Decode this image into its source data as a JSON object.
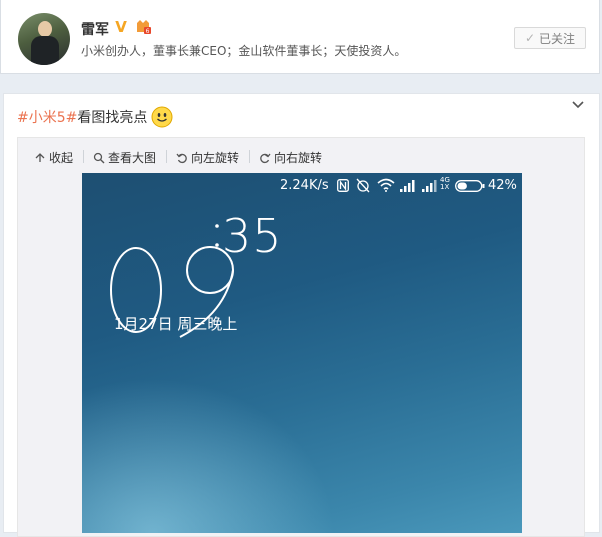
{
  "profile": {
    "name": "雷军",
    "bio": "小米创办人，董事长兼CEO；金山软件董事长；天使投资人。",
    "follow_label": "已关注"
  },
  "post": {
    "hashtag": "#小米5#",
    "text": " 看图找亮点"
  },
  "media_toolbar": {
    "collapse": "收起",
    "view_large": "查看大图",
    "rotate_left": "向左旋转",
    "rotate_right": "向右旋转"
  },
  "phone": {
    "net_speed": "2.24K/s",
    "network_type_top": "4G",
    "network_type_bottom": "1X",
    "battery": "42%",
    "battery_level": 0.42,
    "clock_hours": "09",
    "clock_minutes": "35",
    "date": "1月27日 周三晚上"
  },
  "colors": {
    "hashtag": "#eb7350",
    "verified": "#f5a623",
    "page_bg": "#e8edf3"
  }
}
